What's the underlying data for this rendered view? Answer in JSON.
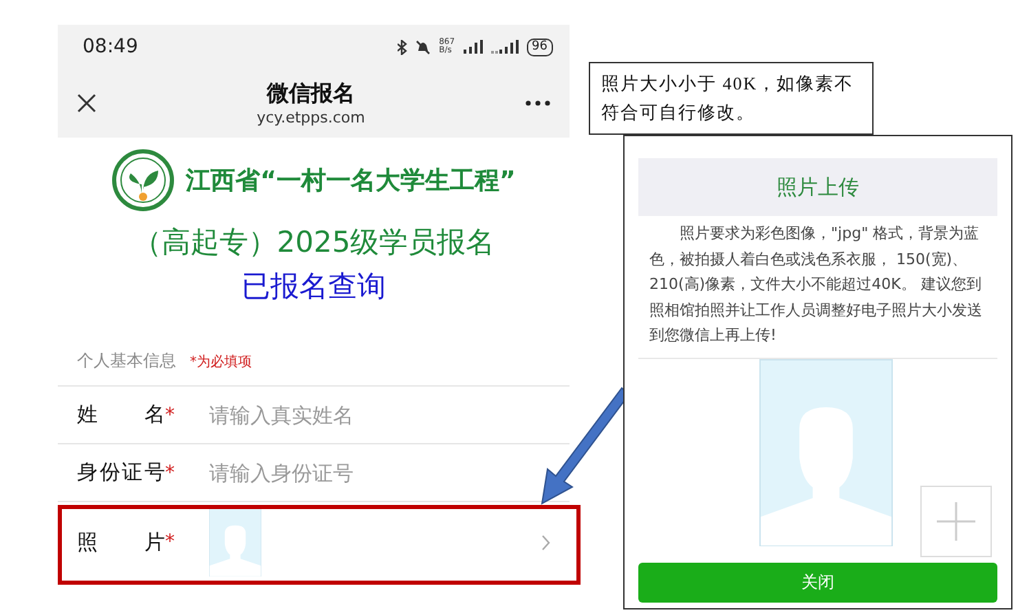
{
  "status_bar": {
    "time": "08:49",
    "net_speed_value": "867",
    "net_speed_unit": "B/s",
    "battery": "96"
  },
  "nav_bar": {
    "title": "微信报名",
    "url": "ycy.etpps.com"
  },
  "banner": {
    "title": "江西省“一村一名大学生工程”",
    "subtitle": "（高起专）2025级学员报名",
    "query_link": "已报名查询"
  },
  "section": {
    "label": "个人基本信息",
    "required_note": "*为必填项"
  },
  "fields": [
    {
      "kind": "text",
      "label": "姓 名",
      "required": true,
      "required_mark": "*",
      "placeholder": "请输入真实姓名"
    },
    {
      "kind": "text",
      "label": "身份证号",
      "required": true,
      "required_mark": "*",
      "placeholder": "请输入身份证号"
    },
    {
      "kind": "photo",
      "label": "照 片",
      "required": true,
      "required_mark": "*",
      "highlighted": true
    }
  ],
  "callout": {
    "text": "照片大小小于 40K，如像素不符合可自行修改。"
  },
  "dialog": {
    "title": "照片上传",
    "description": "照片要求为彩色图像，\"jpg\" 格式，背景为蓝色，被拍摄人着白色或浅色系衣服， 150(宽)、210(高)像素，文件大小不能超过40K。 建议您到照相馆拍照并让工作人员调整好电子照片大小发送到您微信上再上传!",
    "close_button": "关闭"
  }
}
